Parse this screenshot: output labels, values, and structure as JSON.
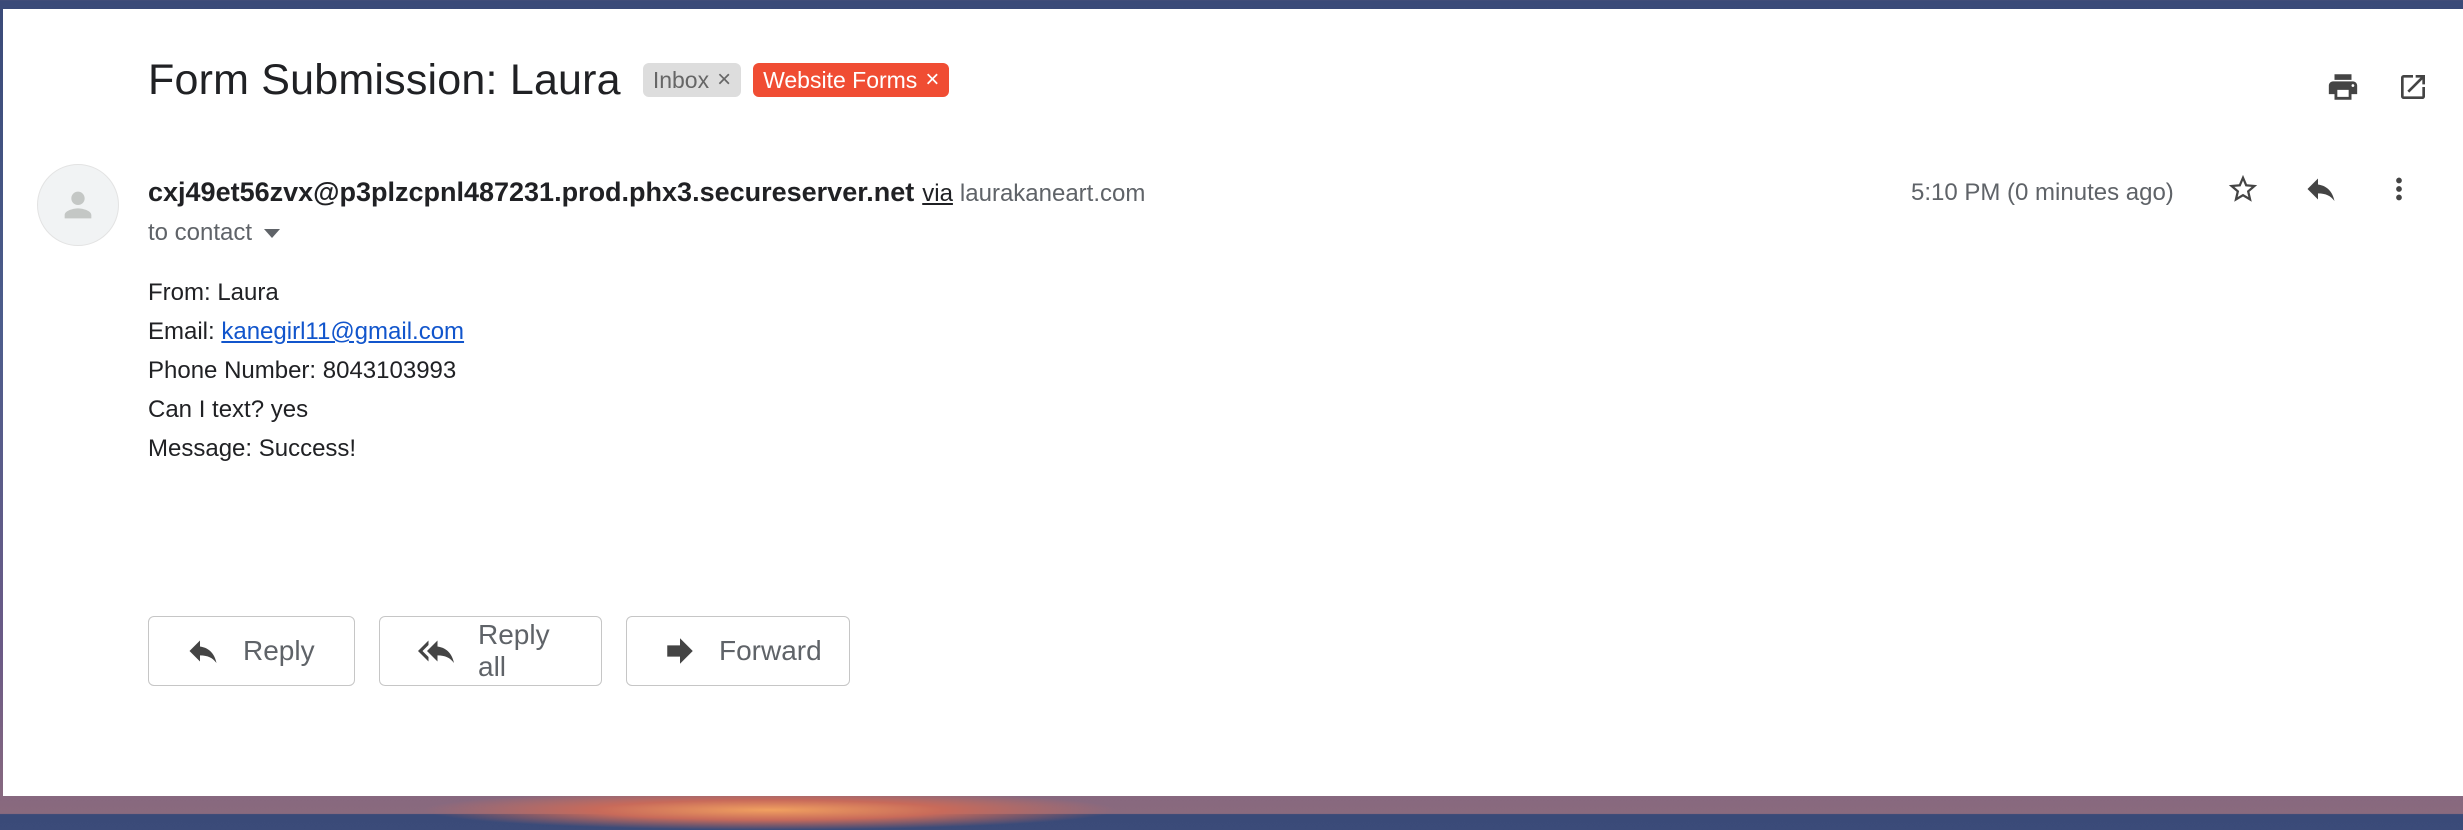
{
  "email": {
    "subject": "Form Submission: Laura",
    "labels": [
      {
        "name": "Inbox",
        "remove": "×"
      },
      {
        "name": "Website Forms",
        "remove": "×"
      }
    ],
    "sender": {
      "address": "cxj49et56zvx@p3plzcpnl487231.prod.phx3.secureserver.net",
      "via_text": "via",
      "via_domain": "laurakaneart.com"
    },
    "recipient_text": "to contact",
    "timestamp": "5:10 PM (0 minutes ago)",
    "body": {
      "from_line": "From: Laura",
      "email_prefix": "Email: ",
      "email_link": "kanegirl11@gmail.com",
      "phone_line": "Phone Number: 8043103993",
      "text_line": "Can I text? yes",
      "message_line": "Message: Success!"
    }
  },
  "actions": {
    "reply": "Reply",
    "reply_all": "Reply all",
    "forward": "Forward"
  },
  "icons": {
    "print": "print-icon",
    "open_new_window": "open-in-new-icon",
    "star": "star-icon",
    "reply": "reply-icon",
    "more": "more-vert-icon",
    "avatar": "person-icon"
  },
  "colors": {
    "website_forms_label": "#f04d33",
    "inbox_label": "#dddddd",
    "link": "#1155cc"
  }
}
